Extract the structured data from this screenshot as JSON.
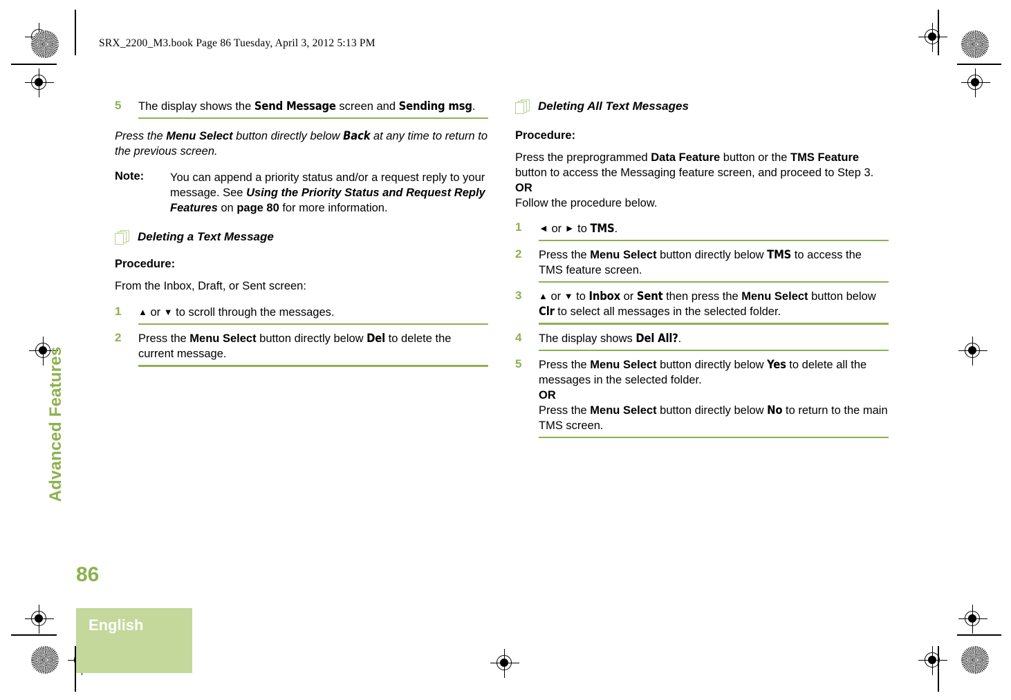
{
  "document": {
    "stamp": "SRX_2200_M3.book  Page 86  Tuesday, April 3, 2012  5:13 PM",
    "chapter_tab": "Advanced Features",
    "page_number": "86",
    "language": "English"
  },
  "colors": {
    "accent_green": "#8cb14e",
    "block_green": "#c3d89a",
    "icon_green": "#b9d18e"
  },
  "left_column": {
    "step5": {
      "number": "5",
      "text_a": "The display shows the ",
      "lcd_a": "Send Message",
      "text_b": " screen and ",
      "lcd_b": "Sending msg",
      "text_c": "."
    },
    "press_note": {
      "a": "Press the ",
      "b": "Menu Select",
      "c": " button directly below ",
      "d": "Back",
      "e": " at any time to return to the previous screen."
    },
    "note": {
      "label": "Note:",
      "a": "You can append a priority status and/or a request reply to your message. See ",
      "b": "Using the Priority Status and Request Reply Features",
      "c": " on ",
      "d": "page 80",
      "e": " for more information."
    },
    "heading": "Deleting a Text Message",
    "procedure_label": "Procedure:",
    "intro": "From the Inbox, Draft, or Sent screen:",
    "steps": [
      {
        "number": "1",
        "arrow_up": "▲",
        "or": " or ",
        "arrow_down": "▼",
        "text": " to scroll through the messages."
      },
      {
        "number": "2",
        "a": "Press the ",
        "b": "Menu Select",
        "c": " button directly below ",
        "d": "Del",
        "e": " to delete the current message."
      }
    ]
  },
  "right_column": {
    "heading": "Deleting All Text Messages",
    "procedure_label": "Procedure:",
    "intro": {
      "a": "Press the preprogrammed ",
      "b": "Data Feature",
      "c": " button or the ",
      "d": "TMS Feature",
      "e": " button to access the Messaging feature screen, and proceed to Step 3.",
      "or": "OR",
      "f": "Follow the procedure below."
    },
    "steps": [
      {
        "number": "1",
        "arrow_left": "◄",
        "or": " or ",
        "arrow_right": "►",
        "to": " to ",
        "lcd": "TMS",
        "tail": "."
      },
      {
        "number": "2",
        "a": "Press the ",
        "b": "Menu Select",
        "c": " button directly below ",
        "d": "TMS",
        "e": " to access the TMS feature screen."
      },
      {
        "number": "3",
        "arrow_up": "▲",
        "or": " or ",
        "arrow_down": "▼",
        "a": " to ",
        "b": "Inbox",
        "c": " or ",
        "d": "Sent",
        "e": " then press the ",
        "f": "Menu Select",
        "g": " button below ",
        "h": "Clr",
        "i": " to select all messages in the selected folder."
      },
      {
        "number": "4",
        "a": "The display shows ",
        "b": "Del All?",
        "c": "."
      },
      {
        "number": "5",
        "a": "Press the ",
        "b": "Menu Select",
        "c": " button directly below ",
        "d": "Yes",
        "e": " to delete all the messages in the selected folder.",
        "or": "OR",
        "f": "Press the ",
        "g": "Menu Select",
        "h": " button directly below ",
        "i": "No",
        "j": " to return to the main TMS screen."
      }
    ]
  }
}
